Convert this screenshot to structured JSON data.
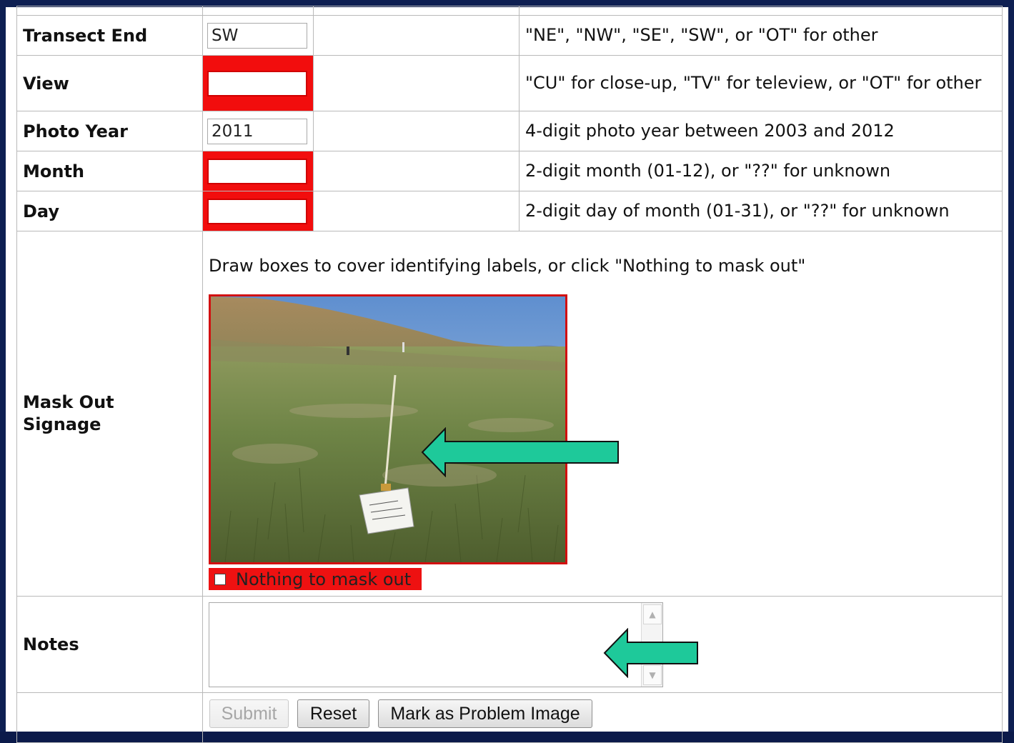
{
  "form": {
    "rows": [
      {
        "label": "Transect End",
        "value": "SW",
        "required_error": false,
        "hint": "\"NE\", \"NW\", \"SE\", \"SW\", or \"OT\" for other"
      },
      {
        "label": "View",
        "value": "",
        "required_error": true,
        "hint": "\"CU\" for close-up, \"TV\" for teleview, or \"OT\" for other"
      },
      {
        "label": "Photo Year",
        "value": "2011",
        "required_error": false,
        "hint": "4-digit photo year between 2003 and 2012"
      },
      {
        "label": "Month",
        "value": "",
        "required_error": true,
        "hint": "2-digit month (01-12), or \"??\" for unknown"
      },
      {
        "label": "Day",
        "value": "",
        "required_error": true,
        "hint": "2-digit day of month (01-31), or \"??\" for unknown"
      }
    ],
    "mask": {
      "label": "Mask Out Signage",
      "instruction": "Draw boxes to cover identifying labels, or click \"Nothing to mask out\"",
      "nothing_label": "Nothing to mask out",
      "nothing_checked": false
    },
    "notes": {
      "label": "Notes",
      "value": ""
    },
    "buttons": {
      "submit": "Submit",
      "reset": "Reset",
      "problem": "Mark as Problem Image"
    }
  },
  "colors": {
    "error_red": "#f20d0d",
    "arrow_green": "#1ec99a",
    "frame_navy": "#0e1f52"
  }
}
